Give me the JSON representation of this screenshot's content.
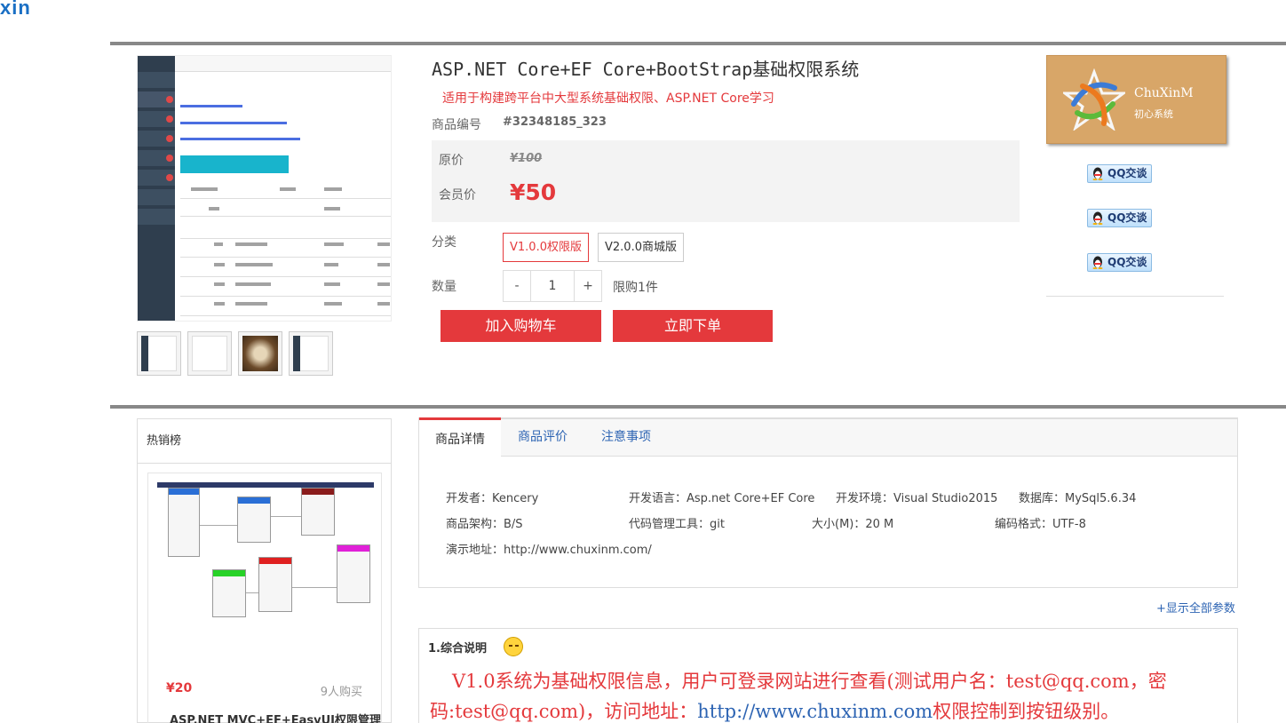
{
  "header": {
    "logo_fragment": "xin"
  },
  "product": {
    "title": "ASP.NET Core+EF Core+BootStrap基础权限系统",
    "subtitle": "适用于构建跨平台中大型系统基础权限、ASP.NET Core学习",
    "sku_label": "商品编号",
    "sku_value": "#32348185_323",
    "original_price_label": "原价",
    "original_price": "¥100",
    "member_price_label": "会员价",
    "member_price": "¥50",
    "category_label": "分类",
    "variants": [
      "V1.0.0权限版",
      "V2.0.0商城版"
    ],
    "selected_variant": "V1.0.0权限版",
    "quantity_label": "数量",
    "quantity_minus": "-",
    "quantity_value": "1",
    "quantity_plus": "+",
    "limit_text": "限购1件",
    "add_to_cart": "加入购物车",
    "buy_now": "立即下单"
  },
  "seller": {
    "brand_name": "ChuXinM",
    "brand_sub": "初心系统",
    "qq_buttons": [
      "QQ交谈",
      "QQ交谈",
      "QQ交谈"
    ]
  },
  "hot_sales": {
    "heading": "热销榜",
    "item": {
      "price": "¥20",
      "buyers": "9人购买",
      "name": "ASP.NET MVC+EF+EasyUI权限管理信息系统"
    }
  },
  "tabs": {
    "items": [
      "商品详情",
      "商品评价",
      "注意事项"
    ],
    "active": "商品详情"
  },
  "details": {
    "developer": "开发者：Kencery",
    "language": "开发语言：Asp.net Core+EF Core",
    "environment": "开发环境：Visual Studio2015",
    "database": "数据库：MySql5.6.34",
    "architecture": "商品架构：B/S",
    "vcs": "代码管理工具：git",
    "size": "大小(M)：20 M",
    "encoding": "编码格式：UTF-8",
    "demo": "演示地址：http://www.chuxinm.com/",
    "show_all": "+显示全部参数"
  },
  "summary": {
    "title": "1.综合说明",
    "body_part1": "V1.0系统为基础权限信息，用户可登录网站进行查看(测试用户名：test@qq.com，密码:test@qq.com)，访问地址：",
    "link": "http://www.chuxinm.com",
    "body_part2": "权限控制到按钮级别。"
  },
  "colors": {
    "accent_red": "#e4393c",
    "link_blue": "#2d64b3",
    "brand_bg": "#d8a668"
  }
}
